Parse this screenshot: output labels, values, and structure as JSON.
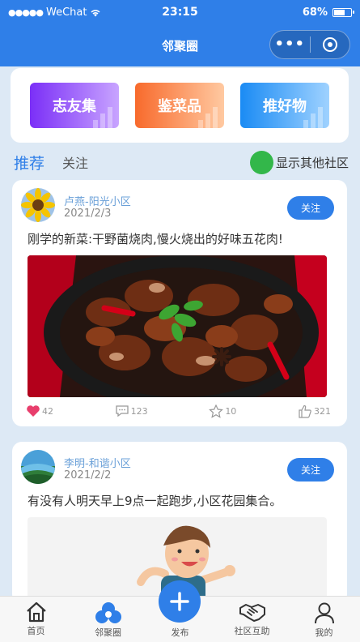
{
  "status_bar": {
    "signal_dots": "●●●●●",
    "carrier": "WeChat",
    "time": "23:15",
    "battery_text": "68%",
    "battery_level": 0.68
  },
  "navbar": {
    "title": "邻聚圈",
    "more_icon": "more-dots-icon",
    "close_icon": "target-circle-icon"
  },
  "categories": [
    {
      "label": "志友集",
      "color": "#7b2ff7"
    },
    {
      "label": "鉴菜品",
      "color": "#f86a2c"
    },
    {
      "label": "推好物",
      "color": "#1a8bf4"
    }
  ],
  "tabs": {
    "recommend": "推荐",
    "follow": "关注",
    "show_others": "显示其他社区"
  },
  "posts": [
    {
      "author": "卢燕-阳光小区",
      "date": "2021/2/3",
      "follow_label": "关注",
      "text": "刚学的新菜:干野菌烧肉,慢火烧出的好味五花肉!",
      "likes": "42",
      "comments": "123",
      "favorites": "10",
      "thumbs": "321"
    },
    {
      "author": "李明-和谐小区",
      "date": "2021/2/2",
      "follow_label": "关注",
      "text": "有没有人明天早上9点一起跑步,小区花园集合。"
    }
  ],
  "tabbar": {
    "home": "首页",
    "circle": "邻聚圈",
    "publish": "发布",
    "mutual": "社区互助",
    "mine": "我的"
  },
  "colors": {
    "brand": "#2f7fe8",
    "toggle_green": "#33b74a",
    "like_red": "#e83e6c"
  }
}
